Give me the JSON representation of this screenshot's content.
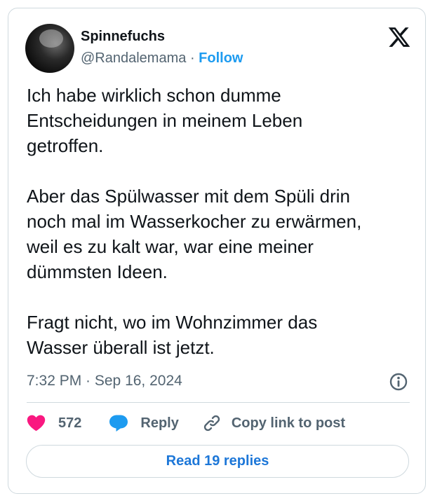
{
  "tweet": {
    "author": {
      "display_name": "Spinnefuchs",
      "handle": "@Randalemama",
      "separator": "·",
      "follow_label": "Follow"
    },
    "text": "Ich habe wirklich schon dumme\nEntscheidungen in meinem Leben\ngetroffen.\n\nAber das Spülwasser mit dem Spüli drin\nnoch mal im Wasserkocher zu erwärmen,\nweil es zu kalt war, war eine meiner\ndümmsten Ideen.\n\nFragt nicht, wo im Wohnzimmer das\nWasser überall ist jetzt.",
    "timestamp": "7:32 PM · Sep 16, 2024",
    "likes": "572",
    "reply_label": "Reply",
    "copy_link_label": "Copy link to post",
    "read_replies_label": "Read 19 replies"
  },
  "icons": {
    "brand": "x-logo-icon",
    "info": "info-icon",
    "like": "heart-icon",
    "reply": "speech-bubble-icon",
    "copy": "link-icon"
  },
  "colors": {
    "accent": "#1d9bf0",
    "like": "#f91880",
    "reply": "#1d9bf0",
    "text": "#0f1419",
    "muted": "#536471",
    "border": "#cfd9de"
  }
}
